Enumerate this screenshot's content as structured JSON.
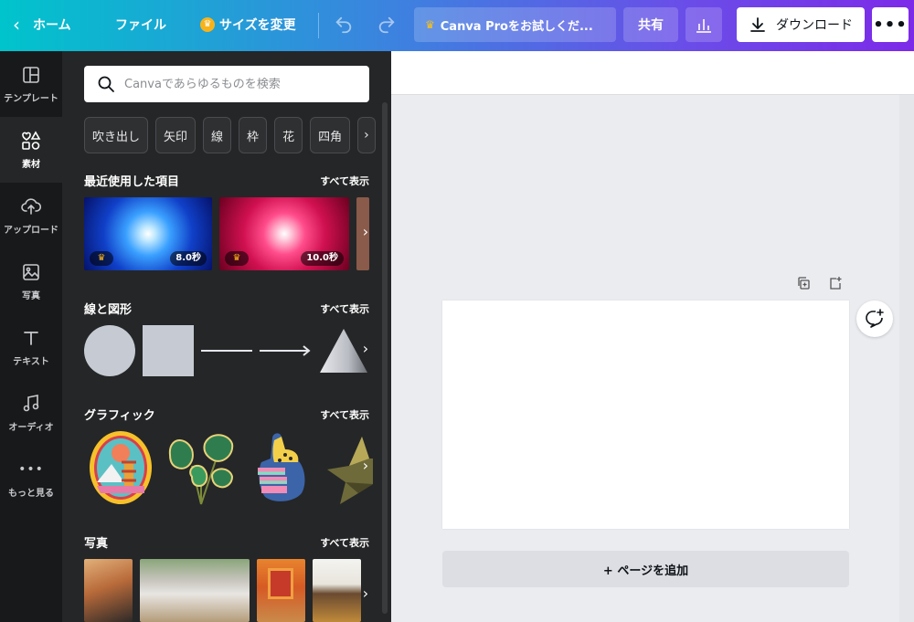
{
  "topbar": {
    "home_label": "ホーム",
    "file_label": "ファイル",
    "resize_label": "サイズを変更",
    "pro_label": "Canva Proをお試しくだ...",
    "share_label": "共有",
    "download_label": "ダウンロード",
    "more_label": "•••"
  },
  "leftnav": {
    "items": [
      {
        "label": "テンプレート",
        "icon": "template-icon"
      },
      {
        "label": "素材",
        "icon": "elements-icon"
      },
      {
        "label": "アップロード",
        "icon": "upload-icon"
      },
      {
        "label": "写真",
        "icon": "photo-icon"
      },
      {
        "label": "テキスト",
        "icon": "text-icon"
      },
      {
        "label": "オーディオ",
        "icon": "audio-icon"
      },
      {
        "label": "もっと見る",
        "icon": "more-icon"
      }
    ],
    "active_index": 1
  },
  "panel": {
    "search_placeholder": "Canvaであらゆるものを検索",
    "chips": [
      "吹き出し",
      "矢印",
      "線",
      "枠",
      "花",
      "四角"
    ],
    "see_all": "すべて表示",
    "sections": {
      "recent": {
        "title": "最近使用した項目",
        "durations": [
          "8.0秒",
          "10.0秒"
        ]
      },
      "shapes": {
        "title": "線と図形"
      },
      "graphics": {
        "title": "グラフィック"
      },
      "photos": {
        "title": "写真"
      }
    }
  },
  "canvas": {
    "add_page_label": "+ ページを追加"
  },
  "colors": {
    "accent_gradient_start": "#00c4cc",
    "accent_gradient_end": "#7d2ae8",
    "panel_bg": "#252627",
    "nav_bg": "#18191b",
    "crown": "#f8b31a"
  }
}
